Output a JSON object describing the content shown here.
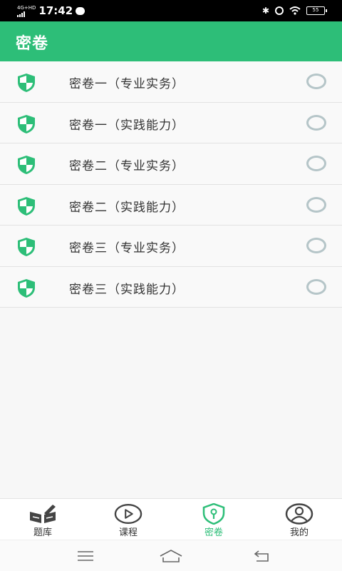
{
  "status_bar": {
    "network": "4G+HD",
    "time": "17:42",
    "battery": "55"
  },
  "header": {
    "title": "密卷"
  },
  "papers": [
    {
      "label": "密卷一（专业实务）",
      "icon": "shield-icon",
      "selected": false
    },
    {
      "label": "密卷一（实践能力）",
      "icon": "shield-icon",
      "selected": false
    },
    {
      "label": "密卷二（专业实务）",
      "icon": "shield-icon",
      "selected": false
    },
    {
      "label": "密卷二（实践能力）",
      "icon": "shield-icon",
      "selected": false
    },
    {
      "label": "密卷三（专业实务）",
      "icon": "shield-icon",
      "selected": false
    },
    {
      "label": "密卷三（实践能力）",
      "icon": "shield-icon",
      "selected": false
    }
  ],
  "tabs": [
    {
      "label": "题库",
      "icon": "question-bank-icon",
      "active": false
    },
    {
      "label": "课程",
      "icon": "play-icon",
      "active": false
    },
    {
      "label": "密卷",
      "icon": "lock-shield-icon",
      "active": true
    },
    {
      "label": "我的",
      "icon": "user-icon",
      "active": false
    }
  ],
  "nav": {
    "menu_icon": "menu-icon",
    "home_icon": "home-icon",
    "back_icon": "back-icon"
  },
  "colors": {
    "accent": "#2dbe78",
    "radio": "#b5c5c8",
    "text": "#333333"
  }
}
